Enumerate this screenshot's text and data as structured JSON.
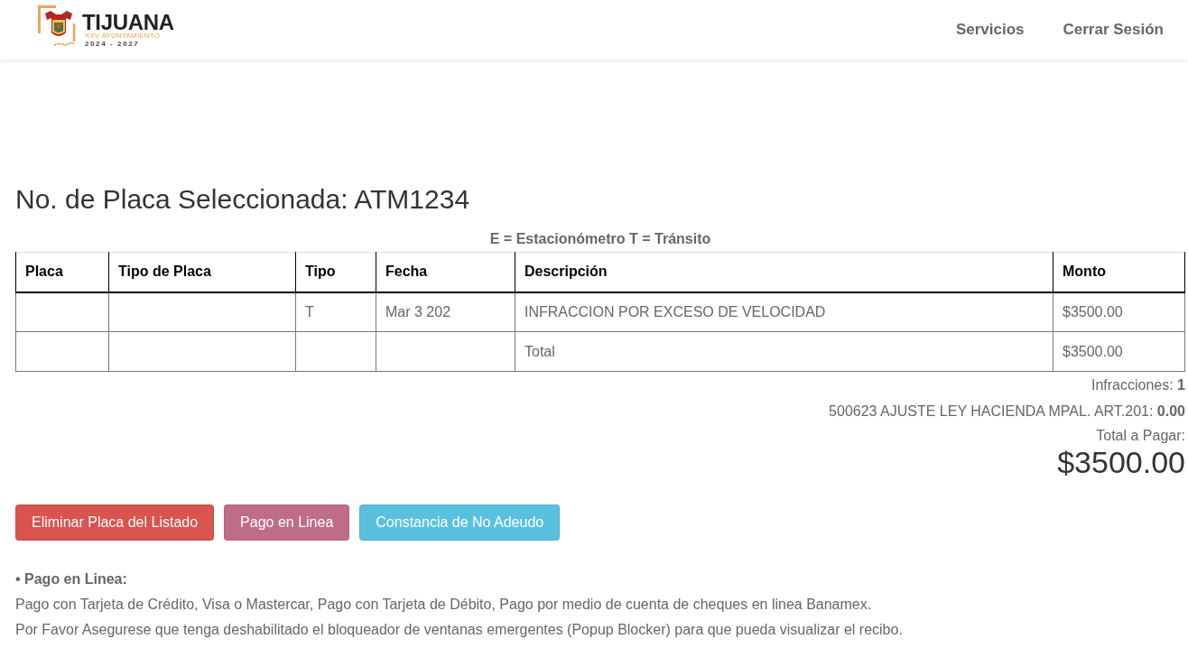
{
  "navbar": {
    "logo": {
      "title": "TIJUANA",
      "subtitle": "XXV AYUNTAMIENTO",
      "years": "2024 - 2027"
    },
    "links": [
      {
        "label": "Servicios"
      },
      {
        "label": "Cerrar Sesión"
      }
    ]
  },
  "heading": "No. de Placa Seleccionada: ATM1234",
  "legend": "E = Estacionómetro T = Tránsito",
  "table": {
    "columns": [
      "Placa",
      "Tipo de Placa",
      "Tipo",
      "Fecha",
      "Descripción",
      "Monto"
    ],
    "rows": [
      [
        null,
        null,
        "T",
        "Mar 3 202",
        "INFRACCION POR EXCESO DE VELOCIDAD",
        "$3500.00"
      ],
      [
        null,
        null,
        null,
        null,
        "Total",
        "$3500.00"
      ]
    ]
  },
  "summary": {
    "lines": [
      "Infracciones: **1**",
      "500623 AJUSTE LEY HACIENDA MPAL. ART.201: **0.00**"
    ],
    "total_label": "Total a Pagar:",
    "total_amount": "$3500.00"
  },
  "buttons": [
    {
      "label": "Eliminar Placa del Listado",
      "color": "#d9534f"
    },
    {
      "label": "Pago en Linea",
      "color": "#bf6d86"
    },
    {
      "label": "Constancia de No Adeudo",
      "color": "#5bc0de"
    }
  ],
  "info": {
    "title": "• Pago en Linea:",
    "lines": [
      "Pago con Tarjeta de Crédito, Visa o Mastercar, Pago con Tarjeta de Débito, Pago por medio de cuenta de cheques en linea Banamex.",
      "Por Favor Asegurese que tenga deshabilitado el bloqueador de ventanas emergentes (Popup Blocker) para que pueda visualizar el recibo."
    ]
  }
}
